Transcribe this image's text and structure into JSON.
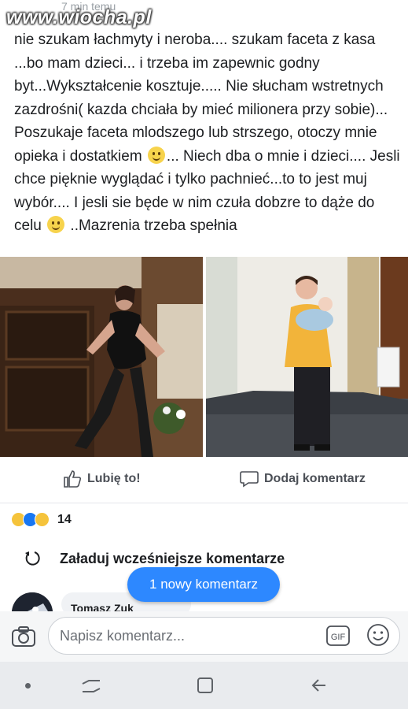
{
  "watermark": "www.wiocha.pl",
  "post": {
    "timestamp": "7 min temu",
    "text": {
      "part1": "nie szukam łachmyty i neroba.... szukam faceta z kasa ...bo mam dzieci... i trzeba im zapewnic godny byt...Wykształcenie kosztuje..... Nie słucham wstretnych zazdrośni( kazda chciała by mieć milionera przy sobie)... Poszukaje faceta mlodszego lub strszego, otoczy mnie opieka i dostatkiem ",
      "part2": "... Niech dba o mnie i dzieci.... Jesli chce pięknie wyglądać i tylko pachnieć...to to jest muj wybór.... I jesli sie będe w nim czuła dobzre to dąże do celu ",
      "part3": " ..Mazrenia trzeba spełnia"
    }
  },
  "actions": {
    "like_label": "Lubię to!",
    "comment_label": "Dodaj komentarz"
  },
  "reactions": {
    "count": "14",
    "types": [
      "haha",
      "like",
      "wow"
    ]
  },
  "comments": {
    "load_previous_label": "Załaduj wcześniejsze komentarze",
    "new_comment_pill": "1 nowy komentarz",
    "preview_author": "Tomasz Zuk"
  },
  "composer": {
    "placeholder": "Napisz komentarz...",
    "gif_label": "GIF"
  },
  "icons": [
    "thumbs-up-icon",
    "comment-icon",
    "reload-icon",
    "camera-icon",
    "gif-icon",
    "emoji-icon",
    "nav-recents-icon",
    "nav-home-icon",
    "nav-back-icon"
  ],
  "colors": {
    "accent_blue": "#2d88ff",
    "text": "#1c1e21",
    "secondary_text": "#4b4f56"
  }
}
